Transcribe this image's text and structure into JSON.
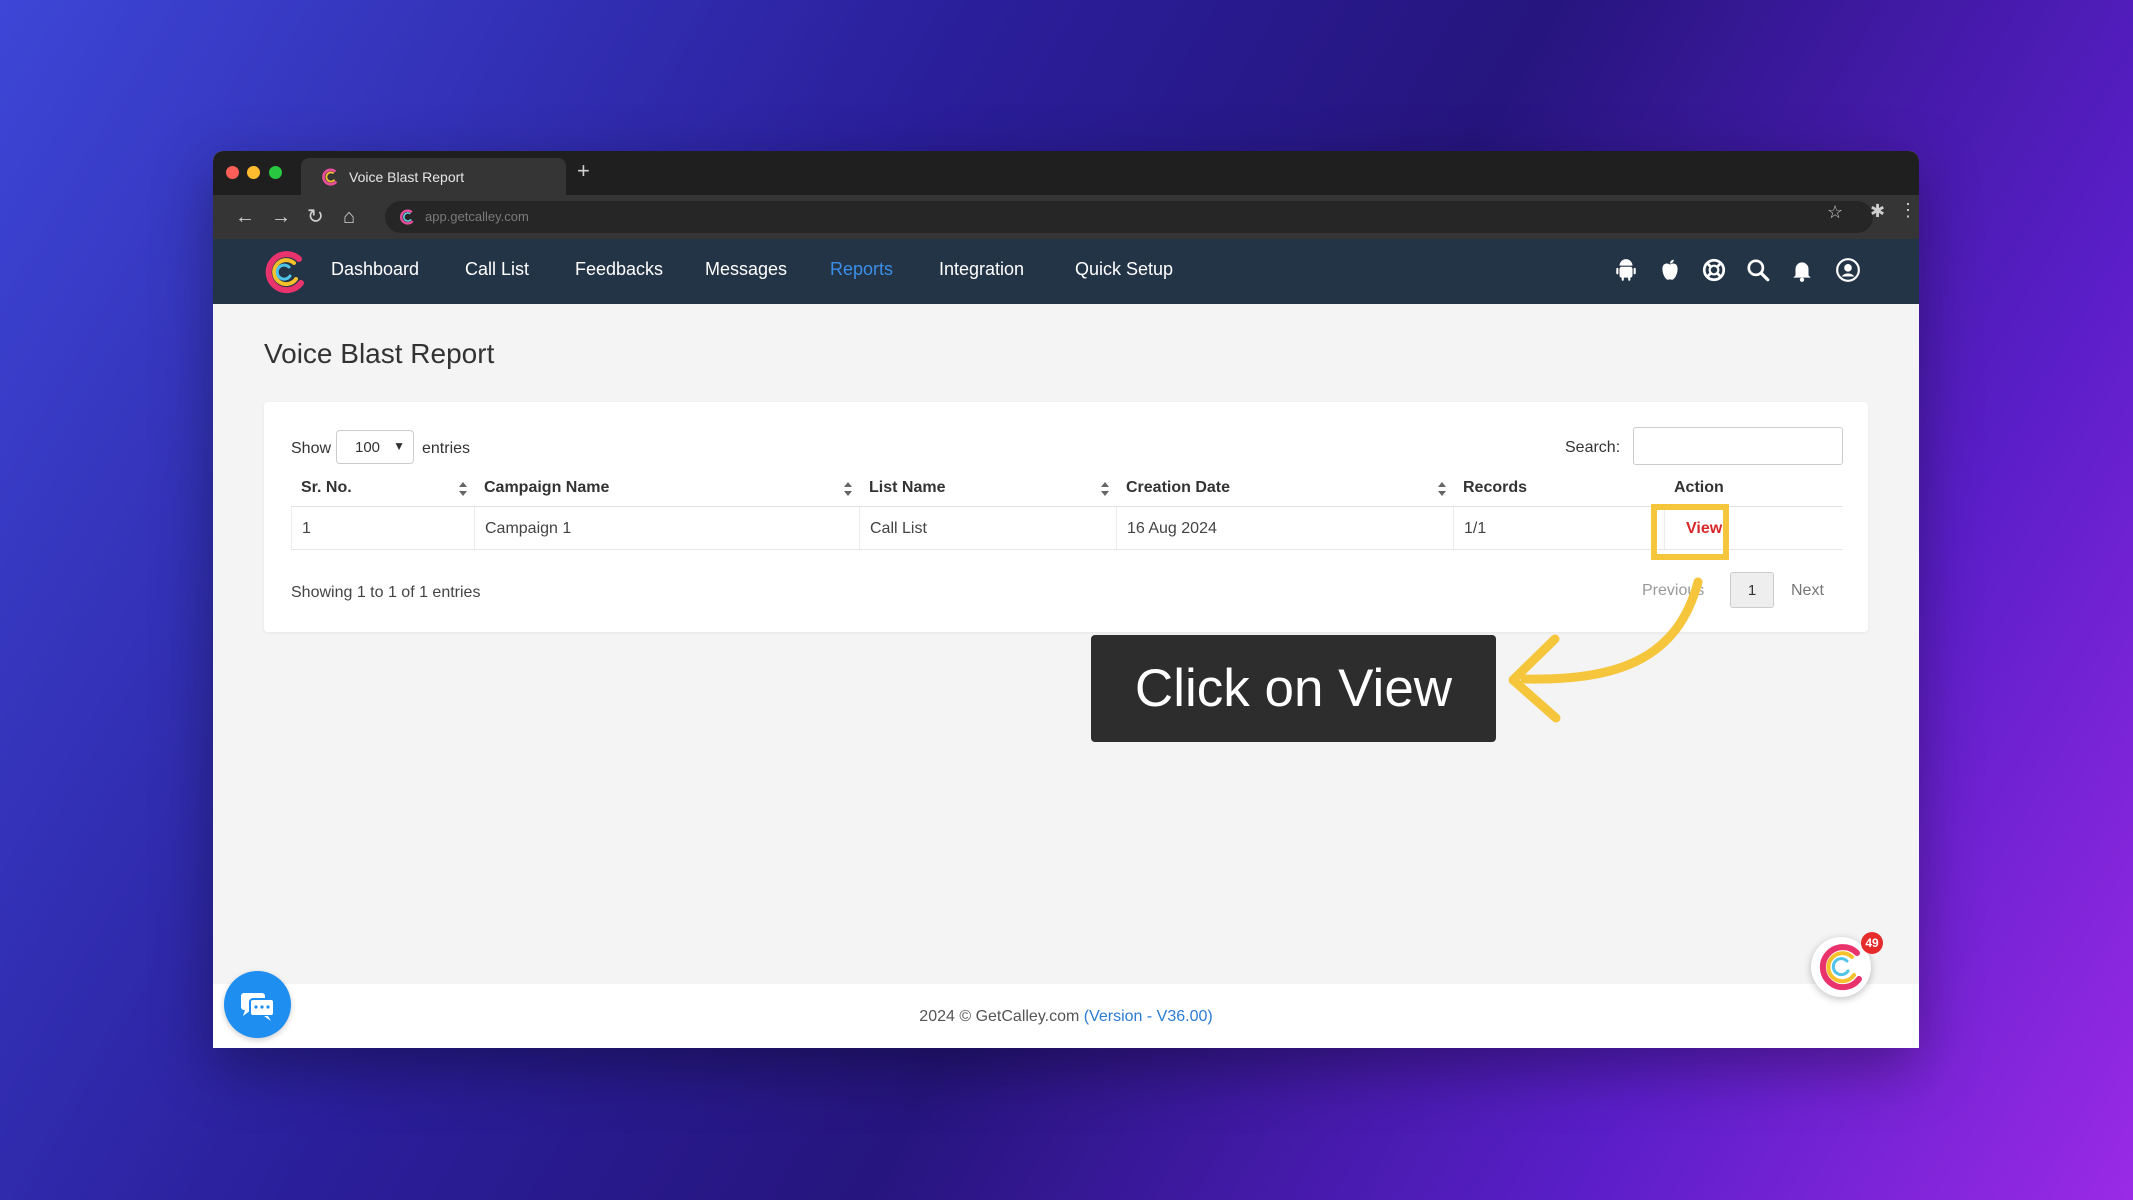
{
  "browser": {
    "tab_title": "Voice Blast Report",
    "new_tab_glyph": "+",
    "url": "app.getcalley.com",
    "icons": [
      "back-icon",
      "forward-icon",
      "reload-icon",
      "home-icon",
      "star-icon",
      "extensions-icon",
      "menu-icon"
    ]
  },
  "nav": {
    "items": [
      {
        "label": "Dashboard"
      },
      {
        "label": "Call List"
      },
      {
        "label": "Feedbacks"
      },
      {
        "label": "Messages"
      },
      {
        "label": "Reports",
        "active": true
      },
      {
        "label": "Integration"
      },
      {
        "label": "Quick Setup"
      }
    ],
    "icons": [
      "android-icon",
      "apple-icon",
      "help-lifebuoy-icon",
      "search-icon",
      "bell-icon",
      "user-account-icon"
    ],
    "active_color": "#3a8fe8",
    "bar_color": "#243447"
  },
  "page": {
    "title": "Voice Blast Report"
  },
  "table_controls": {
    "show_label": "Show",
    "entries_value": "100",
    "entries_label": "entries",
    "search_label": "Search:",
    "search_value": ""
  },
  "table": {
    "columns": [
      "Sr. No.",
      "Campaign Name",
      "List Name",
      "Creation Date",
      "Records",
      "Action"
    ],
    "rows": [
      {
        "sr": "1",
        "campaign": "Campaign 1",
        "list": "Call List",
        "date": "16 Aug 2024",
        "records": "1/1",
        "action": "View"
      }
    ]
  },
  "pagination": {
    "info": "Showing 1 to 1 of 1 entries",
    "previous": "Previous",
    "current_page": "1",
    "next": "Next"
  },
  "annotation": {
    "callout_text": "Click on View",
    "highlight_color": "#f5c63c"
  },
  "footer": {
    "copyright": "2024 © GetCalley.com ",
    "version": "(Version - V36.00)"
  },
  "widgets": {
    "notification_count": "49"
  }
}
